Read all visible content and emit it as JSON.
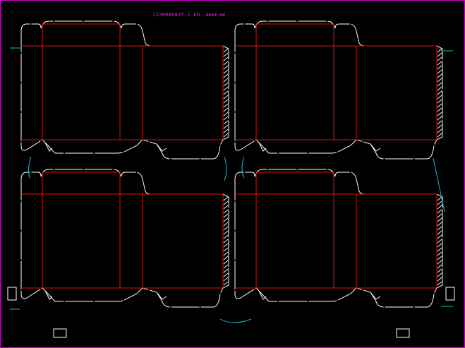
{
  "drawing": {
    "title_code": "JZ2008083T-1 KD",
    "title_note_1": "####",
    "title_note_2": "##"
  },
  "colors": {
    "frame": "#d000d0",
    "title": "#e020e0",
    "cut_line": "#ffffff",
    "fold_line": "#e01010",
    "link_line": "#18b8d0",
    "background": "#000000"
  },
  "layout_info": {
    "rows": 2,
    "columns": 2,
    "dielines_count": 4
  }
}
